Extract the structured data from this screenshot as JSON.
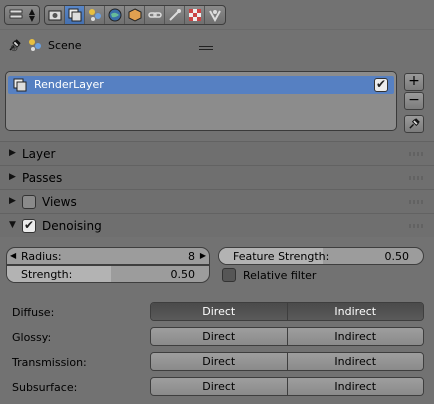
{
  "header": {
    "editor_type_icon": "properties-editor-icon",
    "context_tabs": [
      {
        "icon": "render-icon",
        "active": false
      },
      {
        "icon": "render-layers-icon",
        "active": true
      },
      {
        "icon": "scene-icon",
        "active": false
      },
      {
        "icon": "world-icon",
        "active": false
      },
      {
        "icon": "object-icon",
        "active": false
      },
      {
        "icon": "constraints-icon",
        "active": false
      },
      {
        "icon": "modifiers-icon",
        "active": false
      },
      {
        "icon": "texture-icon",
        "active": false
      },
      {
        "icon": "physics-icon",
        "active": false
      }
    ]
  },
  "breadcrumb": {
    "scene": "Scene"
  },
  "layers_list": {
    "items": [
      {
        "name": "RenderLayer",
        "enabled": true
      }
    ],
    "add_label": "+",
    "remove_label": "−"
  },
  "panels": {
    "layer": "Layer",
    "passes": "Passes",
    "views": "Views",
    "denoising": "Denoising"
  },
  "denoising": {
    "radius_label": "Radius:",
    "radius_value": "8",
    "strength_label": "Strength:",
    "strength_value": "0.50",
    "feature_strength_label": "Feature Strength:",
    "feature_strength_value": "0.50",
    "relative_filter_label": "Relative filter",
    "relative_filter": false
  },
  "passes_table": [
    {
      "label": "Diffuse:",
      "direct": "Direct",
      "indirect": "Indirect",
      "direct_on": true,
      "indirect_on": true
    },
    {
      "label": "Glossy:",
      "direct": "Direct",
      "indirect": "Indirect",
      "direct_on": false,
      "indirect_on": false
    },
    {
      "label": "Transmission:",
      "direct": "Direct",
      "indirect": "Indirect",
      "direct_on": false,
      "indirect_on": false
    },
    {
      "label": "Subsurface:",
      "direct": "Direct",
      "indirect": "Indirect",
      "direct_on": false,
      "indirect_on": false
    }
  ]
}
